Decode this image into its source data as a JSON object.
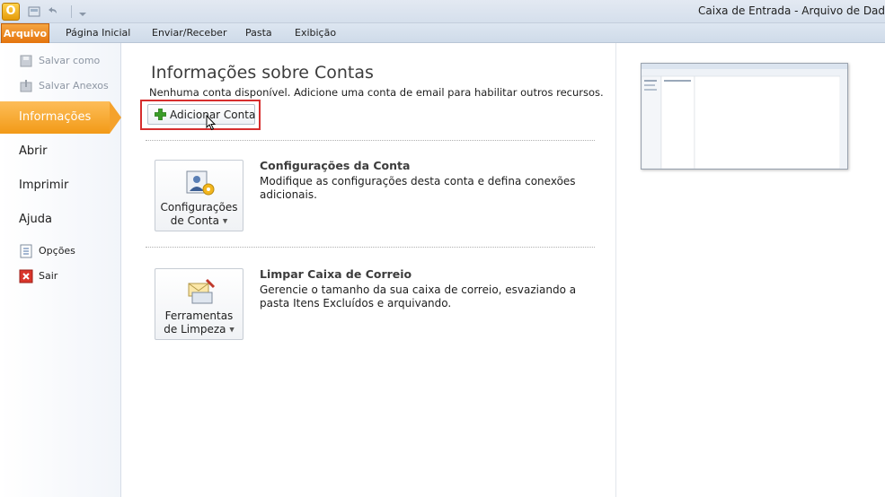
{
  "window": {
    "title": "Caixa de Entrada - Arquivo de Dados do"
  },
  "ribbon": {
    "file_tab": "Arquivo",
    "tabs": [
      "Página Inicial",
      "Enviar/Receber",
      "Pasta",
      "Exibição"
    ]
  },
  "nav": {
    "save_as": "Salvar como",
    "save_attachments": "Salvar Anexos",
    "info": "Informações",
    "open": "Abrir",
    "print": "Imprimir",
    "help": "Ajuda",
    "options": "Opções",
    "exit": "Sair"
  },
  "info": {
    "title": "Informações sobre Contas",
    "no_account": "Nenhuma conta disponível. Adicione uma conta de email para habilitar outros recursos.",
    "add_account": "Adicionar Conta",
    "account_settings": {
      "button_line1": "Configurações",
      "button_line2": "de Conta",
      "title": "Configurações da Conta",
      "description": "Modifique as configurações desta conta e defina conexões adicionais."
    },
    "cleanup": {
      "button_line1": "Ferramentas",
      "button_line2": "de Limpeza",
      "title": "Limpar Caixa de Correio",
      "description": "Gerencie o tamanho da sua caixa de correio, esvaziando a pasta Itens Excluídos e arquivando."
    }
  },
  "colors": {
    "file_tab": "#e4740d",
    "selected_nav": "#f29a17",
    "highlight_border": "#d62e2e",
    "add_icon": "#3a9c28"
  }
}
